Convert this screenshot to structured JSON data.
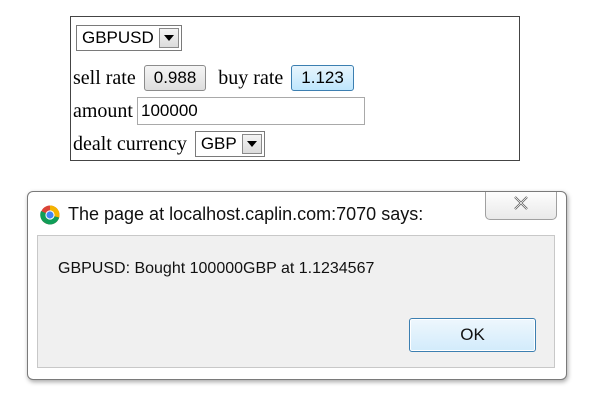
{
  "ticket": {
    "currency_pair": {
      "selected": "GBPUSD",
      "arrow_icon": "chevron-down-icon"
    },
    "sell_rate": {
      "label": "sell rate",
      "value": "0.988"
    },
    "buy_rate": {
      "label": "buy rate",
      "value": "1.123"
    },
    "amount": {
      "label": "amount",
      "value": "100000"
    },
    "dealt_currency": {
      "label": "dealt currency",
      "selected": "GBP",
      "arrow_icon": "chevron-down-icon"
    }
  },
  "dialog": {
    "title": "The page at localhost.caplin.com:7070 says:",
    "app_icon": "chrome-icon",
    "close_icon": "close-icon",
    "message": "GBPUSD: Bought 100000GBP at 1.1234567",
    "ok_label": "OK"
  },
  "colors": {
    "buy_button_bg": "#bee6fd",
    "buy_button_border": "#3c7fb1",
    "dialog_body_bg": "#f0f0f0",
    "panel_border": "#444444"
  }
}
